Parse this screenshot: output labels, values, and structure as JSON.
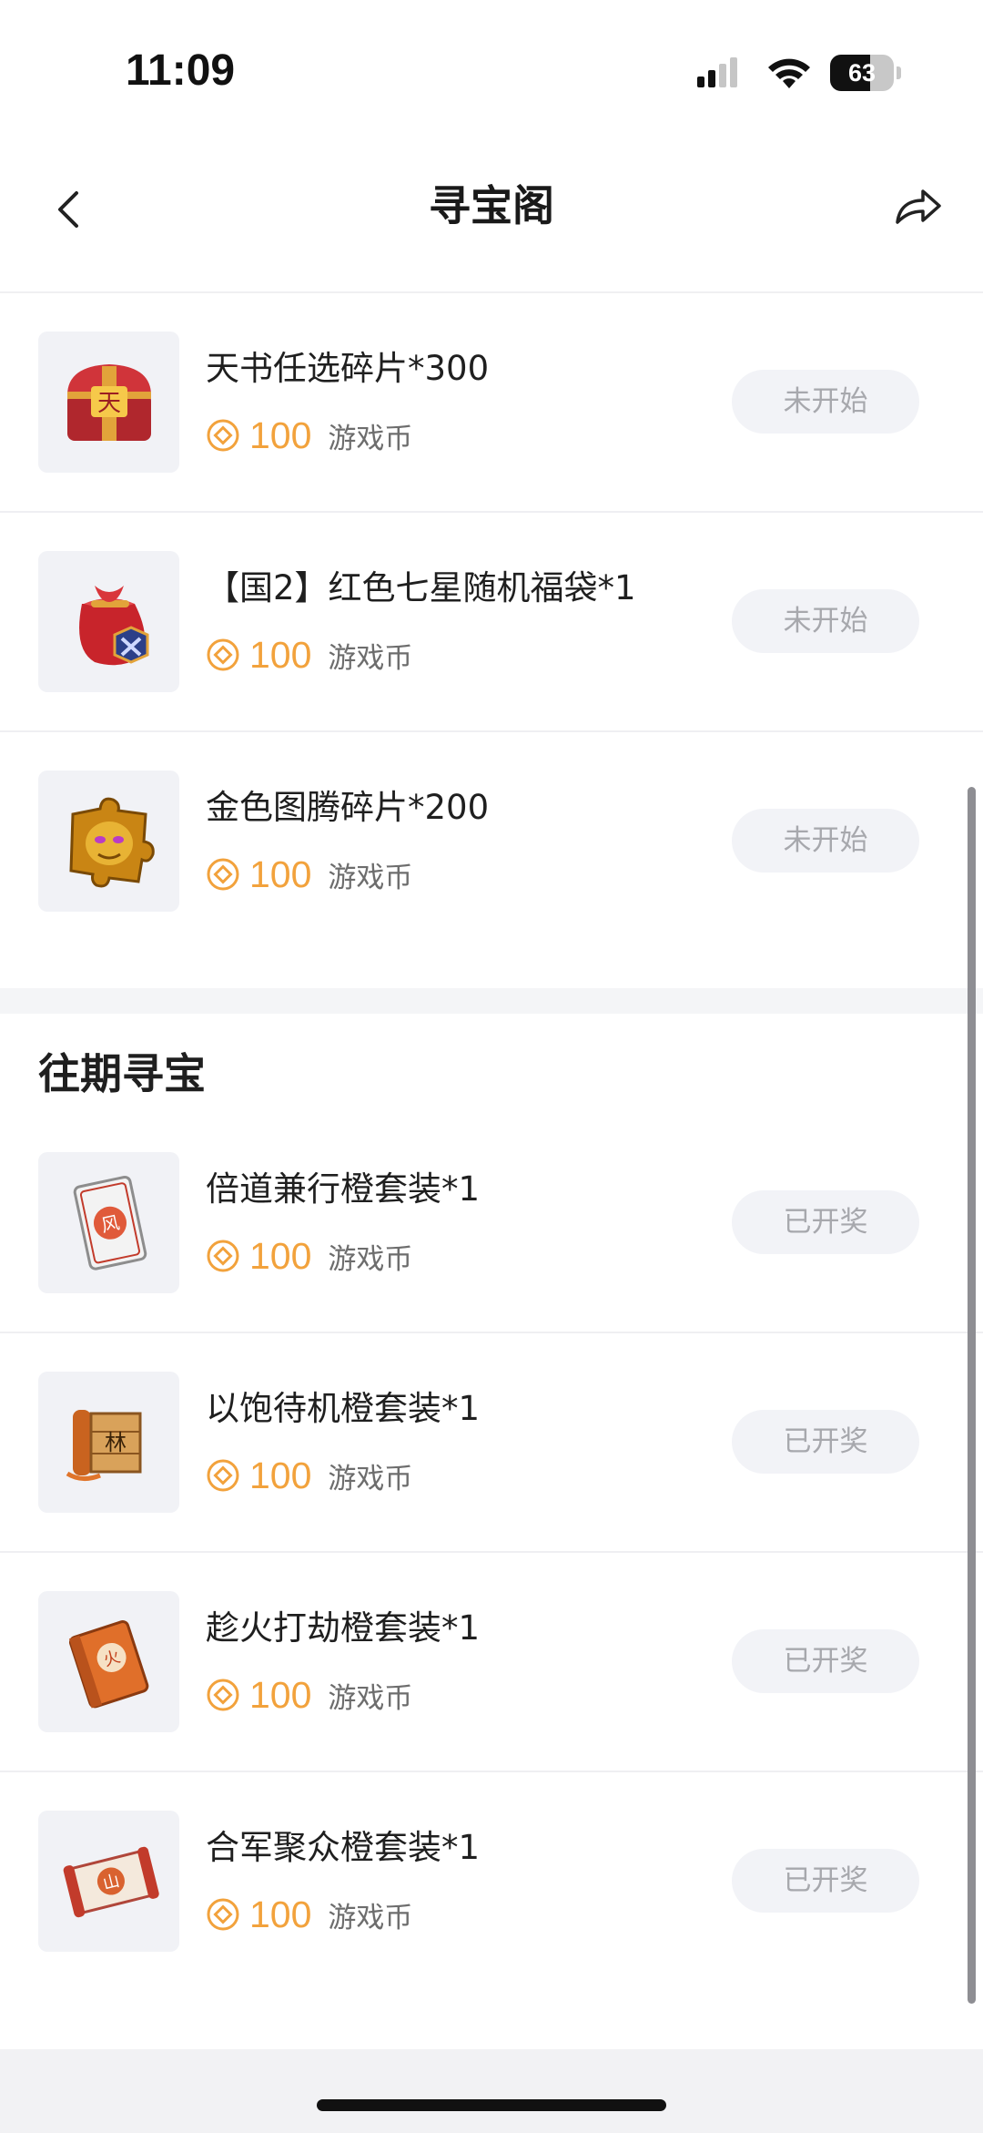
{
  "status_bar": {
    "time": "11:09",
    "battery_level": "63",
    "battery_fraction": 0.63
  },
  "nav": {
    "title": "寻宝阁",
    "back_icon": "chevron-left-icon",
    "share_icon": "share-icon"
  },
  "current_items": [
    {
      "name": "天书任选碎片*300",
      "price": "100",
      "currency": "游戏币",
      "status": "未开始",
      "icon": "red-treasure-chest-icon"
    },
    {
      "name": "【国2】红色七星随机福袋*1",
      "price": "100",
      "currency": "游戏币",
      "status": "未开始",
      "icon": "red-lucky-bag-icon"
    },
    {
      "name": "金色图腾碎片*200",
      "price": "100",
      "currency": "游戏币",
      "status": "未开始",
      "icon": "gold-totem-fragment-icon"
    }
  ],
  "past_section": {
    "title": "往期寻宝",
    "items": [
      {
        "name": "倍道兼行橙套装*1",
        "price": "100",
        "currency": "游戏币",
        "status": "已开奖",
        "icon": "wind-card-icon"
      },
      {
        "name": "以饱待机橙套装*1",
        "price": "100",
        "currency": "游戏币",
        "status": "已开奖",
        "icon": "forest-scroll-icon"
      },
      {
        "name": "趁火打劫橙套装*1",
        "price": "100",
        "currency": "游戏币",
        "status": "已开奖",
        "icon": "fire-book-icon"
      },
      {
        "name": "合军聚众橙套装*1",
        "price": "100",
        "currency": "游戏币",
        "status": "已开奖",
        "icon": "mountain-scroll-icon"
      }
    ]
  },
  "colors": {
    "price": "#f2a23c",
    "button_bg": "#f2f3f7",
    "button_text": "#a7a8ad"
  }
}
